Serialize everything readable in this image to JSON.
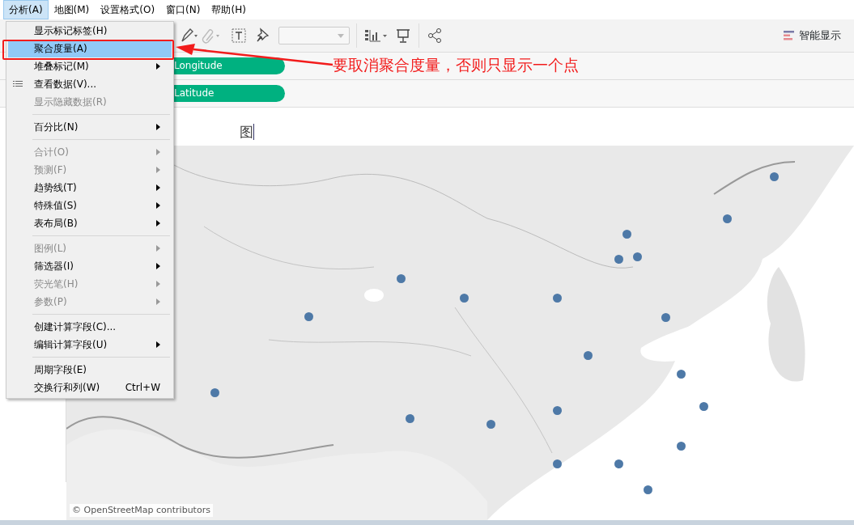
{
  "menubar": [
    {
      "label": "分析(A)",
      "selected": true
    },
    {
      "label": "地图(M)",
      "selected": false
    },
    {
      "label": "设置格式(O)",
      "selected": false
    },
    {
      "label": "窗口(N)",
      "selected": false
    },
    {
      "label": "帮助(H)",
      "selected": false
    }
  ],
  "menu": [
    {
      "kind": "item",
      "label": "显示标记标签(H)",
      "selected": false,
      "disabled": false,
      "submenu": false
    },
    {
      "kind": "item",
      "label": "聚合度量(A)",
      "selected": true,
      "disabled": false,
      "submenu": false
    },
    {
      "kind": "item",
      "label": "堆叠标记(M)",
      "selected": false,
      "disabled": false,
      "submenu": true
    },
    {
      "kind": "item",
      "label": "查看数据(V)...",
      "selected": false,
      "disabled": false,
      "submenu": false,
      "has_icon": true
    },
    {
      "kind": "item",
      "label": "显示隐藏数据(R)",
      "selected": false,
      "disabled": true,
      "submenu": false
    },
    {
      "kind": "separator"
    },
    {
      "kind": "item",
      "label": "百分比(N)",
      "selected": false,
      "disabled": false,
      "submenu": true
    },
    {
      "kind": "separator"
    },
    {
      "kind": "item",
      "label": "合计(O)",
      "selected": false,
      "disabled": true,
      "submenu": true
    },
    {
      "kind": "item",
      "label": "预测(F)",
      "selected": false,
      "disabled": true,
      "submenu": true
    },
    {
      "kind": "item",
      "label": "趋势线(T)",
      "selected": false,
      "disabled": false,
      "submenu": true
    },
    {
      "kind": "item",
      "label": "特殊值(S)",
      "selected": false,
      "disabled": false,
      "submenu": true
    },
    {
      "kind": "item",
      "label": "表布局(B)",
      "selected": false,
      "disabled": false,
      "submenu": true
    },
    {
      "kind": "separator"
    },
    {
      "kind": "item",
      "label": "图例(L)",
      "selected": false,
      "disabled": true,
      "submenu": true
    },
    {
      "kind": "item",
      "label": "筛选器(I)",
      "selected": false,
      "disabled": false,
      "submenu": true
    },
    {
      "kind": "item",
      "label": "荧光笔(H)",
      "selected": false,
      "disabled": true,
      "submenu": true
    },
    {
      "kind": "item",
      "label": "参数(P)",
      "selected": false,
      "disabled": true,
      "submenu": true
    },
    {
      "kind": "separator"
    },
    {
      "kind": "item",
      "label": "创建计算字段(C)...",
      "selected": false,
      "disabled": false,
      "submenu": false
    },
    {
      "kind": "item",
      "label": "编辑计算字段(U)",
      "selected": false,
      "disabled": false,
      "submenu": true
    },
    {
      "kind": "separator"
    },
    {
      "kind": "item",
      "label": "周期字段(E)",
      "selected": false,
      "disabled": false,
      "submenu": false
    },
    {
      "kind": "item",
      "label": "交换行和列(W)",
      "selected": false,
      "disabled": false,
      "submenu": false,
      "shortcut": "Ctrl+W"
    }
  ],
  "toolbar": {
    "show_me": "智能显示"
  },
  "shelves": [
    {
      "pill": "Longitude"
    },
    {
      "pill": "Latitude"
    }
  ],
  "sheet_title": "图",
  "map": {
    "kind": "picture",
    "attribution": "© OpenStreetMap contributors"
  },
  "annotation": {
    "text": "要取消聚合度量，否则只显示一个点"
  }
}
